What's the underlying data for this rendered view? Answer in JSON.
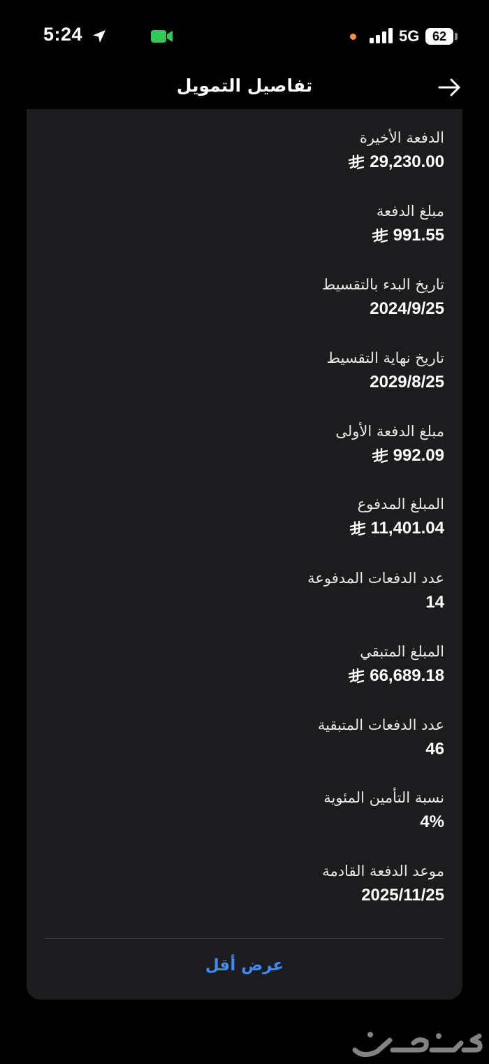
{
  "status_bar": {
    "time": "5:24",
    "network": "5G",
    "battery": "62",
    "icons": [
      "location-arrow-icon",
      "facetime-camera-icon",
      "recording-dot",
      "cellular-signal-icon",
      "battery-icon"
    ]
  },
  "header": {
    "title": "تفاصيل التمويل",
    "back_icon": "arrow-right-icon"
  },
  "details": [
    {
      "label": "الدفعة الأخيرة",
      "value": "29,230.00",
      "currency": true
    },
    {
      "label": "مبلغ الدفعة",
      "value": "991.55",
      "currency": true
    },
    {
      "label": "تاريخ البدء بالتقسيط",
      "value": "2024/9/25",
      "currency": false
    },
    {
      "label": "تاريخ نهاية التقسيط",
      "value": "2029/8/25",
      "currency": false
    },
    {
      "label": "مبلغ الدفعة الأولى",
      "value": "992.09",
      "currency": true
    },
    {
      "label": "المبلغ المدفوع",
      "value": "11,401.04",
      "currency": true
    },
    {
      "label": "عدد الدفعات المدفوعة",
      "value": "14",
      "currency": false
    },
    {
      "label": "المبلغ المتبقي",
      "value": "66,689.18",
      "currency": true
    },
    {
      "label": "عدد الدفعات المتبقية",
      "value": "46",
      "currency": false
    },
    {
      "label": "نسبة التأمين المئوية",
      "value": "4%",
      "currency": false
    },
    {
      "label": "موعد الدفعة القادمة",
      "value": "2025/11/25",
      "currency": false
    }
  ],
  "actions": {
    "show_less": "عرض أقل"
  },
  "watermark": {
    "text": "حراج"
  },
  "colors": {
    "background": "#000000",
    "card": "#1c1c1e",
    "link": "#3d8bf5",
    "facetime": "#34c759",
    "recording": "#f5923e"
  }
}
